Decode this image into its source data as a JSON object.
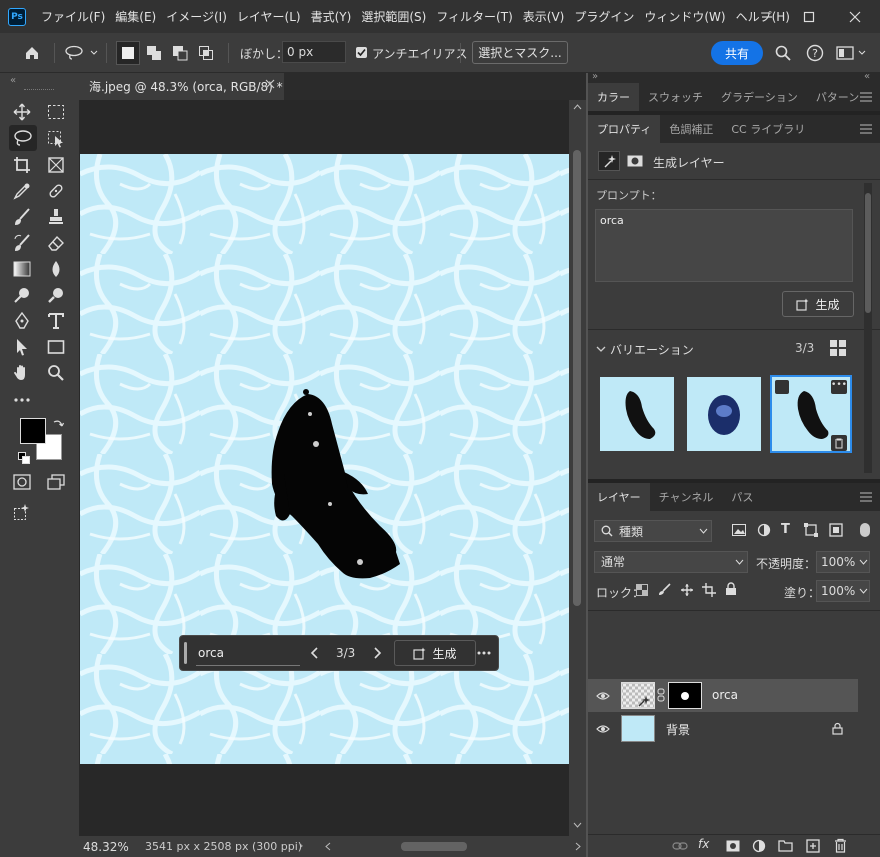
{
  "app": {
    "logo": "Ps"
  },
  "menu": [
    "ファイル(F)",
    "編集(E)",
    "イメージ(I)",
    "レイヤー(L)",
    "書式(Y)",
    "選択範囲(S)",
    "フィルター(T)",
    "表示(V)",
    "プラグイン",
    "ウィンドウ(W)",
    "ヘルプ(H)"
  ],
  "options": {
    "feather_label": "ぼかし：",
    "feather_value": "0 px",
    "antialias_label": "アンチエイリアス",
    "antialias_checked": true,
    "select_mask": "選択とマスク...",
    "share": "共有"
  },
  "document": {
    "tab_title": "海.jpeg @ 48.3% (orca, RGB/8) *",
    "zoom": "48.32%",
    "info": "3541 px x 2508 px (300 ppi)"
  },
  "taskbar": {
    "prompt": "orca",
    "counter": "3/3",
    "generate": "生成"
  },
  "panels": {
    "top_tabs": [
      "カラー",
      "スウォッチ",
      "グラデーション",
      "パターン"
    ],
    "prop_tabs": [
      "プロパティ",
      "色調補正",
      "CC ライブラリ"
    ],
    "layer_type": "生成レイヤー",
    "prompt_label": "プロンプト：",
    "prompt_value": "orca",
    "generate": "生成",
    "variations_label": "バリエーション",
    "variations_count": "3/3"
  },
  "layers_panel": {
    "tabs": [
      "レイヤー",
      "チャンネル",
      "パス"
    ],
    "filter": "種類",
    "blend_mode": "通常",
    "opacity_label": "不透明度：",
    "opacity": "100%",
    "lock_label": "ロック：",
    "fill_label": "塗り：",
    "fill": "100%",
    "layers": [
      {
        "name": "orca",
        "selected": true
      },
      {
        "name": "背景",
        "locked": true
      }
    ]
  },
  "colors": {
    "accent": "#1473e6",
    "water": "#bfe9f7",
    "panel": "#3c3c3c",
    "dark": "#323232"
  }
}
